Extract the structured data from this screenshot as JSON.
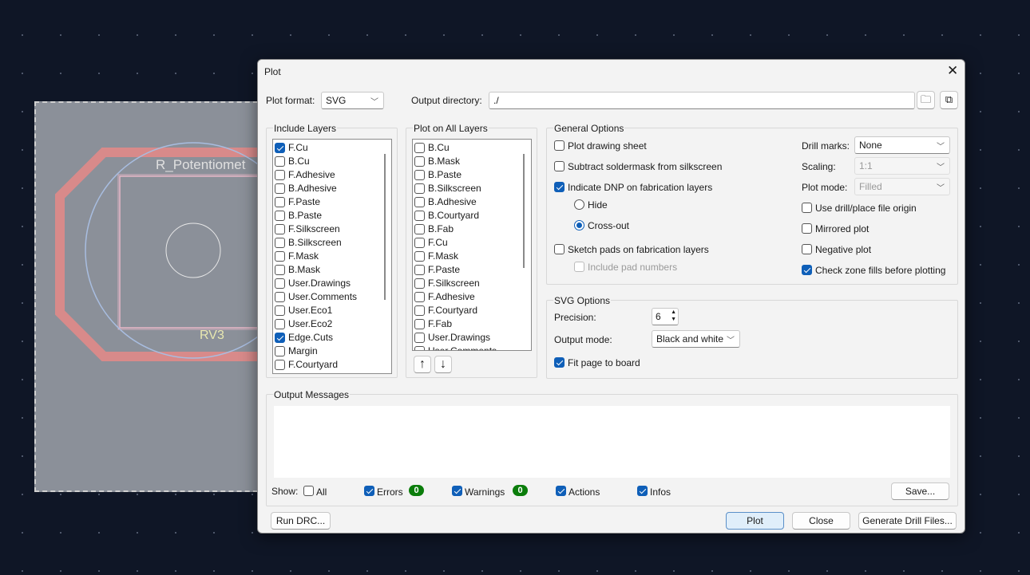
{
  "pcb": {
    "ref_text": "R_Potentiomet",
    "value_text": "RV3"
  },
  "dialog": {
    "title": "Plot",
    "close_icon": "x-icon"
  },
  "format": {
    "label": "Plot format:",
    "value": "SVG"
  },
  "output_dir": {
    "label": "Output directory:",
    "value": "./"
  },
  "include_layers": {
    "title": "Include Layers",
    "items": [
      {
        "label": "F.Cu",
        "checked": true
      },
      {
        "label": "B.Cu",
        "checked": false
      },
      {
        "label": "F.Adhesive",
        "checked": false
      },
      {
        "label": "B.Adhesive",
        "checked": false
      },
      {
        "label": "F.Paste",
        "checked": false
      },
      {
        "label": "B.Paste",
        "checked": false
      },
      {
        "label": "F.Silkscreen",
        "checked": false
      },
      {
        "label": "B.Silkscreen",
        "checked": false
      },
      {
        "label": "F.Mask",
        "checked": false
      },
      {
        "label": "B.Mask",
        "checked": false
      },
      {
        "label": "User.Drawings",
        "checked": false
      },
      {
        "label": "User.Comments",
        "checked": false
      },
      {
        "label": "User.Eco1",
        "checked": false
      },
      {
        "label": "User.Eco2",
        "checked": false
      },
      {
        "label": "Edge.Cuts",
        "checked": true
      },
      {
        "label": "Margin",
        "checked": false
      },
      {
        "label": "F.Courtyard",
        "checked": false
      }
    ]
  },
  "all_layers": {
    "title": "Plot on All Layers",
    "items": [
      {
        "label": "B.Cu",
        "checked": false
      },
      {
        "label": "B.Mask",
        "checked": false
      },
      {
        "label": "B.Paste",
        "checked": false
      },
      {
        "label": "B.Silkscreen",
        "checked": false
      },
      {
        "label": "B.Adhesive",
        "checked": false
      },
      {
        "label": "B.Courtyard",
        "checked": false
      },
      {
        "label": "B.Fab",
        "checked": false
      },
      {
        "label": "F.Cu",
        "checked": false
      },
      {
        "label": "F.Mask",
        "checked": false
      },
      {
        "label": "F.Paste",
        "checked": false
      },
      {
        "label": "F.Silkscreen",
        "checked": false
      },
      {
        "label": "F.Adhesive",
        "checked": false
      },
      {
        "label": "F.Courtyard",
        "checked": false
      },
      {
        "label": "F.Fab",
        "checked": false
      },
      {
        "label": "User.Drawings",
        "checked": false
      },
      {
        "label": "User.Comments",
        "checked": false
      }
    ]
  },
  "general": {
    "title": "General Options",
    "plot_sheet": "Plot drawing sheet",
    "subtract_mask": "Subtract soldermask from silkscreen",
    "dnp": "Indicate DNP on fabrication layers",
    "hide": "Hide",
    "crossout": "Cross-out",
    "sketch_pads": "Sketch pads on fabrication layers",
    "pad_numbers": "Include pad numbers",
    "drill_marks_label": "Drill marks:",
    "drill_marks": "None",
    "scaling_label": "Scaling:",
    "scaling": "1:1",
    "plot_mode_label": "Plot mode:",
    "plot_mode": "Filled",
    "origin": "Use drill/place file origin",
    "mirrored": "Mirrored plot",
    "negative": "Negative plot",
    "check_zones": "Check zone fills before plotting"
  },
  "svg": {
    "title": "SVG Options",
    "precision_label": "Precision:",
    "precision": "6",
    "output_mode_label": "Output mode:",
    "output_mode": "Black and white",
    "fit_page": "Fit page to board"
  },
  "messages": {
    "title": "Output Messages",
    "show": "Show:",
    "all": "All",
    "errors": "Errors",
    "errors_count": "0",
    "warnings": "Warnings",
    "warnings_count": "0",
    "actions": "Actions",
    "infos": "Infos",
    "save": "Save..."
  },
  "buttons": {
    "run_drc": "Run DRC...",
    "plot": "Plot",
    "close": "Close",
    "drill": "Generate Drill Files..."
  }
}
